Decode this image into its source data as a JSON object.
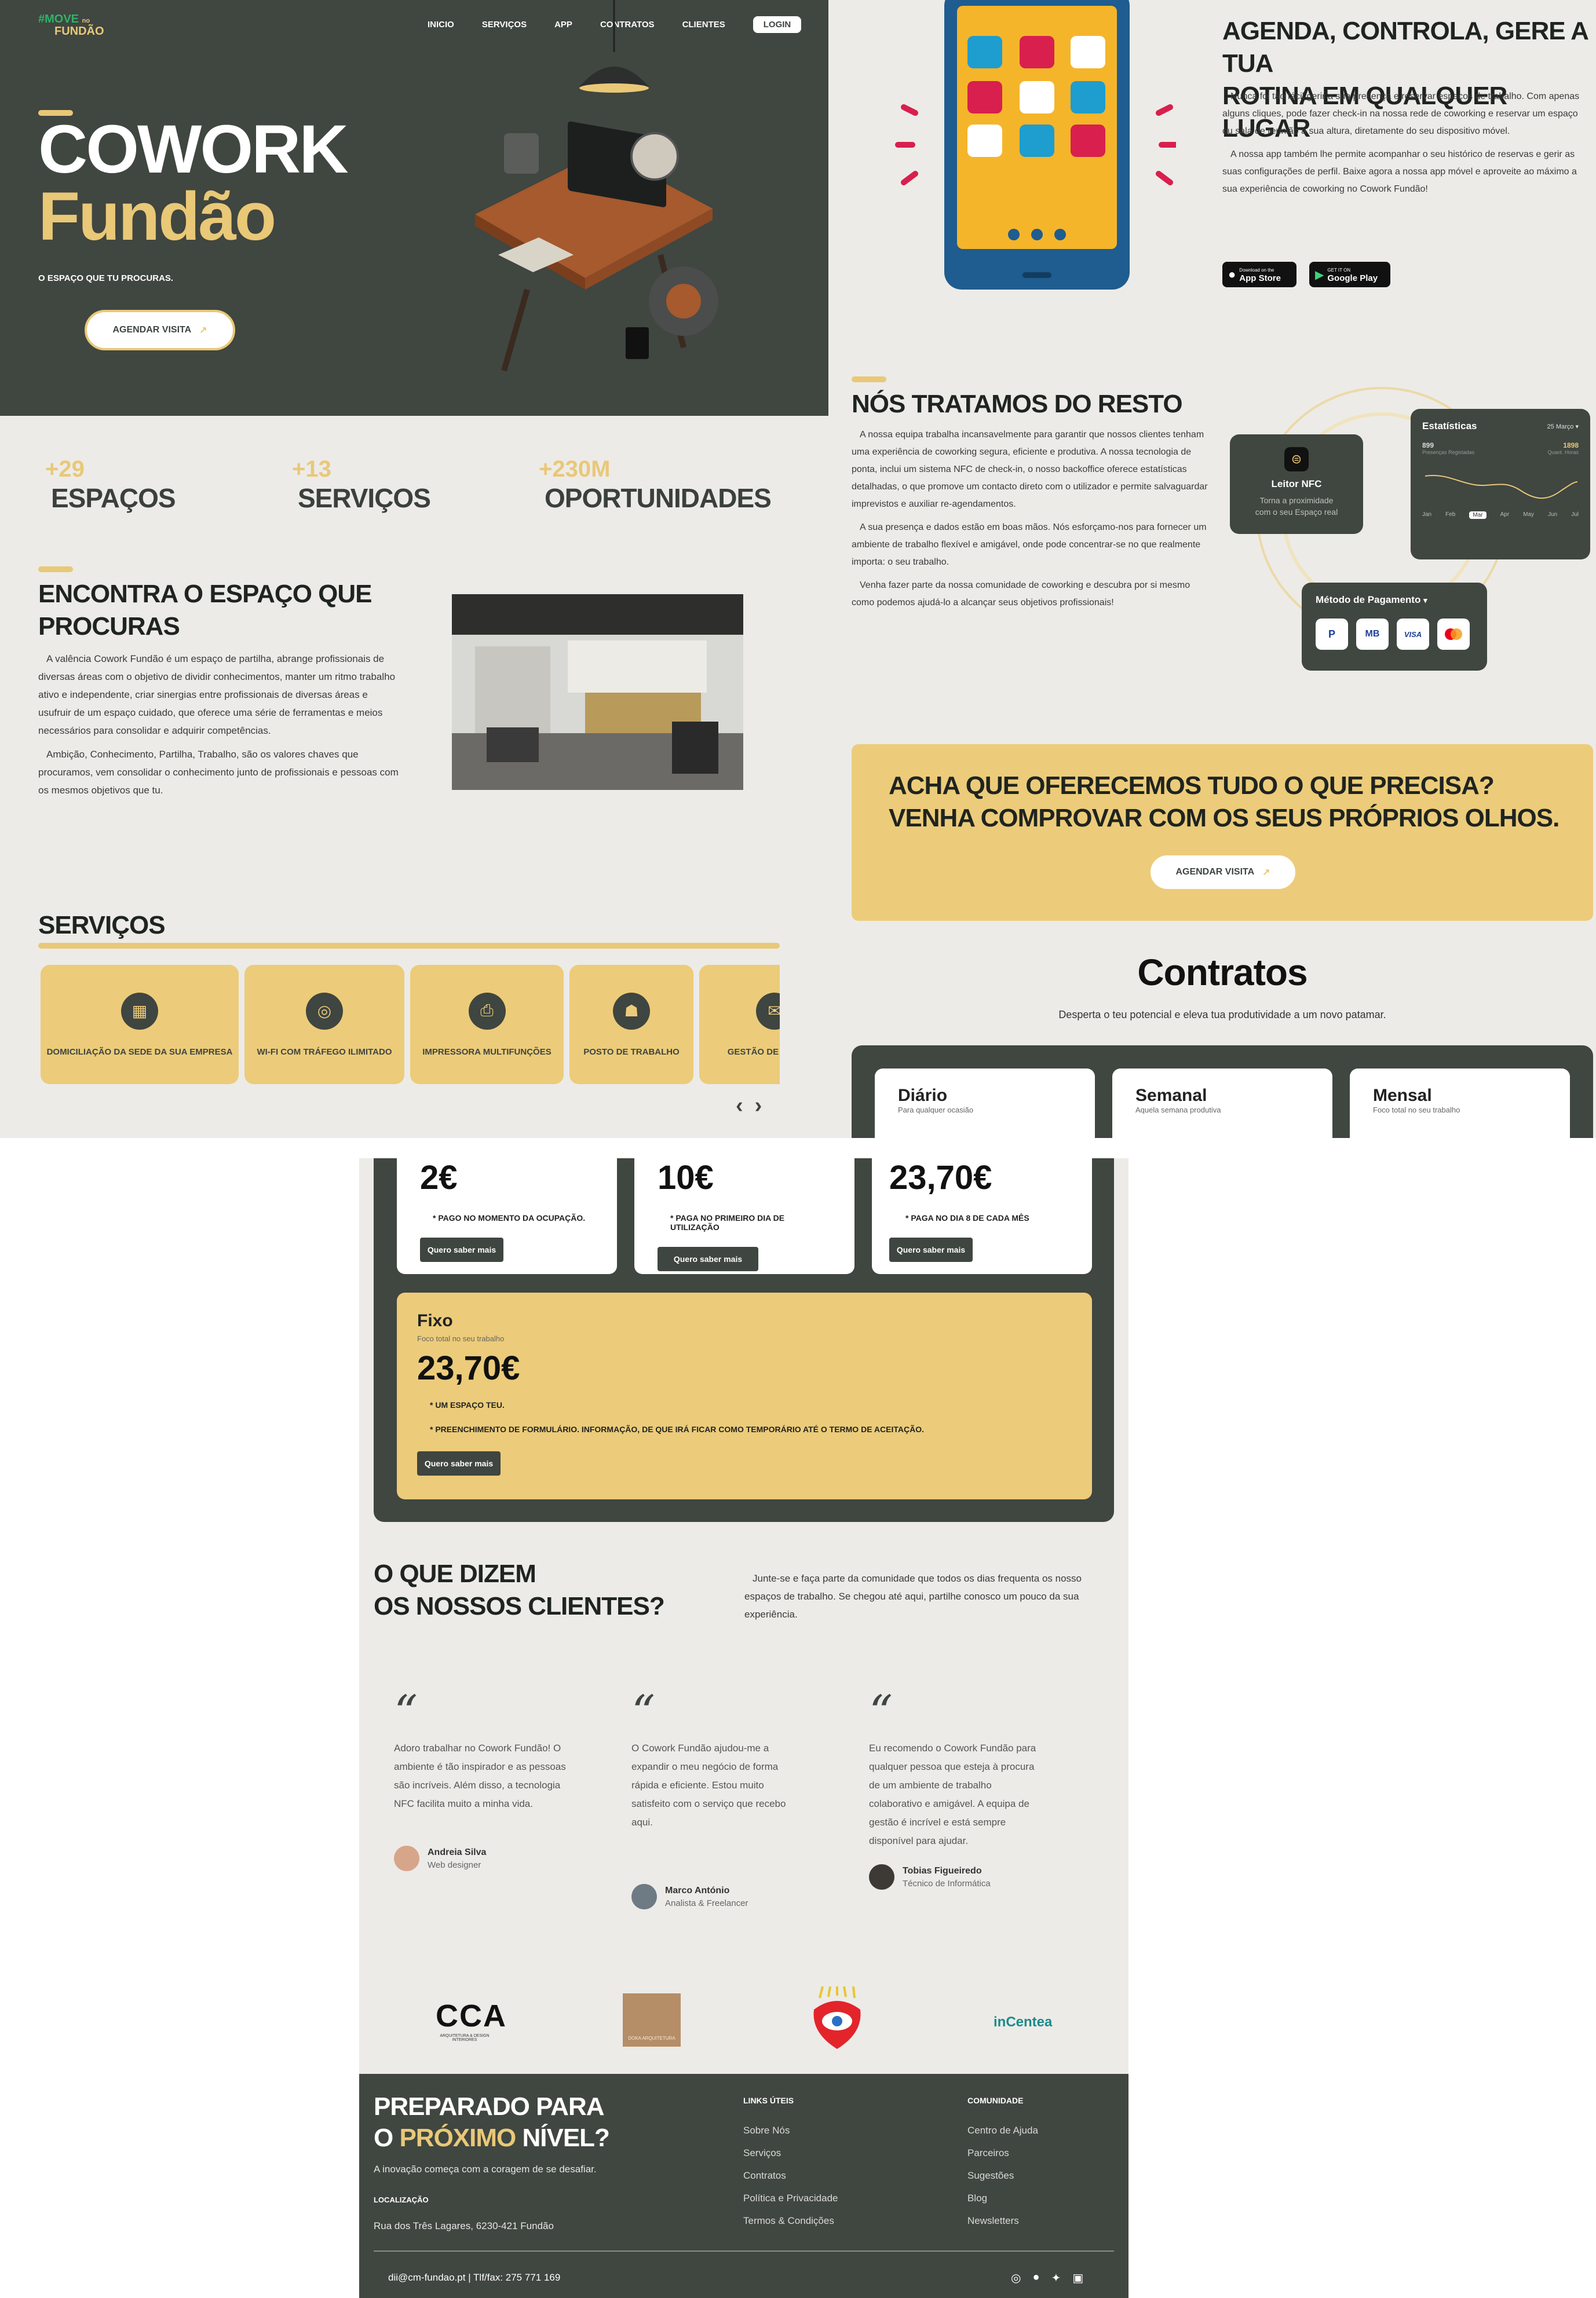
{
  "brand": {
    "logo_top": "#MOVE",
    "logo_small": "no",
    "logo_bottom": "FUNDÃO"
  },
  "nav": {
    "items": [
      "INICIO",
      "SERVIÇOS",
      "APP",
      "CONTRATOS",
      "CLIENTES"
    ],
    "login": "LOGIN"
  },
  "hero": {
    "title_line1": "COWORK",
    "title_line2": "Fundão",
    "tagline": "O ESPAÇO QUE TU PROCURAS.",
    "cta": "AGENDAR VISITA"
  },
  "stats": [
    {
      "num": "+29",
      "label": "ESPAÇOS"
    },
    {
      "num": "+13",
      "label": "SERVIÇOS"
    },
    {
      "num": "+230M",
      "label": "OPORTUNIDADES"
    }
  ],
  "find": {
    "title_l1": "ENCONTRA O ESPAÇO QUE",
    "title_l2": "PROCURAS",
    "p1": "A valência Cowork Fundão é um espaço de partilha, abrange profissionais de diversas áreas com o objetivo de dividir conhecimentos, manter um ritmo trabalho ativo e independente, criar sinergias entre profissionais de diversas áreas e usufruir de um espaço cuidado, que oferece uma série de ferramentas e meios necessários para consolidar e adquirir competências.",
    "p2": "Ambição, Conhecimento, Partilha, Trabalho, são os valores chaves que procuramos, vem consolidar o conhecimento junto de profissionais e pessoas com os mesmos objetivos que tu."
  },
  "services": {
    "title": "SERVIÇOS",
    "items": [
      "DOMICILIAÇÃO DA SEDE DA SUA EMPRESA",
      "WI-FI COM TRÁFEGO ILIMITADO",
      "IMPRESSORA MULTIFUNÇÕES",
      "POSTO DE TRABALHO",
      "GESTÃO DE CORREIO"
    ]
  },
  "app": {
    "title_l1": "AGENDA, CONTROLA, GERE A TUA",
    "title_l2": "ROTINA EM QUALQUER LUGAR",
    "p1": "Nunca foi tão fácil gerir a sua presença e reservar espaços de trabalho. Com apenas alguns cliques, pode fazer check-in na nossa rede de coworking e reservar um espaço ou sala de reunião à sua altura, diretamente do seu dispositivo móvel.",
    "p2": "A nossa app também lhe permite acompanhar o seu histórico de reservas e gerir as suas configurações de perfil. Baixe agora a nossa app móvel e aproveite ao máximo a sua experiência de coworking no Cowork Fundão!",
    "appstore_small": "Download on the",
    "appstore": "App Store",
    "gplay_small": "GET IT ON",
    "gplay": "Google Play"
  },
  "rest": {
    "title": "NÓS TRATAMOS DO RESTO",
    "p1": "A nossa equipa trabalha incansavelmente para garantir que nossos clientes tenham uma experiência de coworking segura, eficiente e produtiva. A nossa tecnologia de ponta, inclui um sistema NFC de check-in, o nosso backoffice oferece estatísticas detalhadas, o que promove um contacto direto com o utilizador e permite salvaguardar imprevistos e auxiliar re-agendamentos.",
    "p2": "A sua presença e dados estão em boas mãos. Nós esforçamo-nos para fornecer um ambiente de trabalho flexível e amigável, onde pode concentrar-se no que realmente importa: o seu trabalho.",
    "p3": "Venha fazer parte da nossa comunidade de coworking e descubra por si mesmo como podemos ajudá-lo a alcançar seus objetivos profissionais!"
  },
  "nfc": {
    "title": "Leitor NFC",
    "desc_l1": "Torna a proximidade",
    "desc_l2": "com o seu Espaço real"
  },
  "stats_widget": {
    "title": "Estatísticas",
    "date": "25 Março",
    "v1": "899",
    "l1": "Presenças Registadas",
    "v2": "1898",
    "l2": "Quant. Horas",
    "months": [
      "Jan",
      "Feb",
      "Mar",
      "Apr",
      "May",
      "Jun",
      "Jul"
    ],
    "active_month": "Mar"
  },
  "payment": {
    "title": "Método de Pagamento",
    "methods": [
      "PayPal",
      "MB",
      "VISA",
      "Mastercard"
    ]
  },
  "cta_box": {
    "l1": "ACHA QUE OFERECEMOS TUDO O QUE PRECISA?",
    "l2": "VENHA COMPROVAR COM OS SEUS PRÓPRIOS OLHOS.",
    "button": "AGENDAR VISITA"
  },
  "contracts": {
    "title": "Contratos",
    "subtitle": "Desperta o teu potencial e eleva tua produtividade a um novo patamar.",
    "plans": [
      {
        "name": "Diário",
        "desc": "Para qualquer ocasião",
        "price": "2€",
        "note": "* PAGO NO MOMENTO DA OCUPAÇÃO.",
        "button": "Quero saber mais"
      },
      {
        "name": "Semanal",
        "desc": "Aquela semana produtiva",
        "price": "10€",
        "note": "* PAGA NO PRIMEIRO DIA DE UTILIZAÇÃO",
        "button": "Quero saber mais"
      },
      {
        "name": "Mensal",
        "desc": "Foco total no seu trabalho",
        "price": "23,70€",
        "note": "* PAGA NO DIA 8 DE CADA MÊS",
        "button": "Quero saber mais"
      }
    ],
    "fixo": {
      "name": "Fixo",
      "desc": "Foco total no seu trabalho",
      "price": "23,70€",
      "note1": "* UM ESPAÇO TEU.",
      "note2": "* PREENCHIMENTO DE FORMULÁRIO. INFORMAÇÃO, DE QUE IRÁ FICAR COMO TEMPORÁRIO ATÉ O TERMO DE ACEITAÇÃO.",
      "button": "Quero saber mais"
    }
  },
  "testimonials": {
    "title_l1": "O QUE DIZEM",
    "title_l2": "OS NOSSOS CLIENTES?",
    "intro": "Junte-se e faça parte da comunidade que todos os dias frequenta os nosso espaços de trabalho. Se chegou até aqui, partilhe conosco um pouco da sua experiência.",
    "items": [
      {
        "quote": "Adoro trabalhar no Cowork Fundão! O ambiente é tão inspirador e as pessoas são incríveis. Além disso, a tecnologia NFC facilita muito a minha vida.",
        "name": "Andreia Silva",
        "role": "Web designer"
      },
      {
        "quote": "O Cowork Fundão ajudou-me a expandir o meu negócio de forma rápida e eficiente. Estou muito satisfeito com o serviço que recebo aqui.",
        "name": "Marco António",
        "role": "Analista & Freelancer"
      },
      {
        "quote": "Eu recomendo o Cowork Fundão para qualquer pessoa que esteja à procura de um ambiente de trabalho colaborativo e amigável. A equipa de gestão é incrível e está sempre disponível para ajudar.",
        "name": "Tobias Figueiredo",
        "role": "Técnico de Informática"
      }
    ]
  },
  "partners": {
    "cca": "CCA",
    "cca_sub": "ARQUITETURA & DESIGN INTERIORES",
    "doka": "DOKA ARQUITETURA",
    "incentea": "inCentea"
  },
  "footer": {
    "title_l1": "PREPARADO PARA",
    "title_l2a": "O ",
    "title_l2b": "PRÓXIMO",
    "title_l2c": " NÍVEL?",
    "tagline": "A inovação começa com a coragem de se desafiar.",
    "loc_label": "LOCALIZAÇÃO",
    "address": "Rua dos Três Lagares, 6230-421 Fundão",
    "links_title": "LINKS ÚTEIS",
    "links": [
      "Sobre Nós",
      "Serviços",
      "Contratos",
      "Política e Privacidade",
      "Termos & Condições"
    ],
    "community_title": "COMUNIDADE",
    "community": [
      "Centro de Ajuda",
      "Parceiros",
      "Sugestões",
      "Blog",
      "Newsletters"
    ],
    "contact": "dii@cm-fundao.pt | Tlf/fax: 275 771 169"
  },
  "colors": {
    "dark": "#3f4540",
    "gold": "#e9c877",
    "bg": "#ecebe8"
  }
}
